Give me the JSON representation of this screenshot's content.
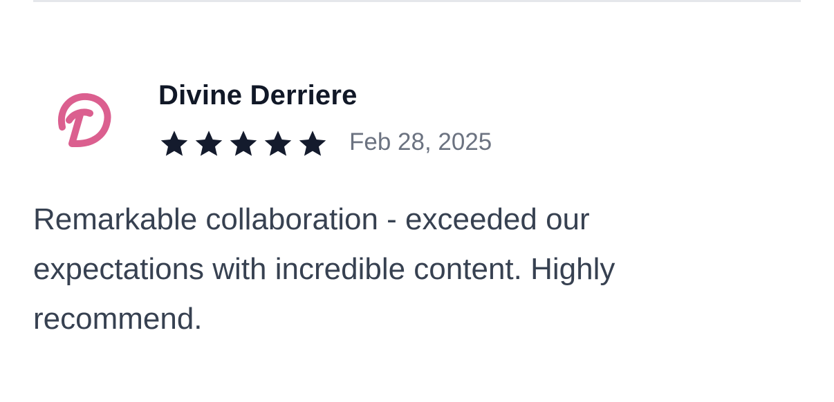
{
  "review": {
    "author": "Divine Derriere",
    "avatar_icon": "divine-derriere-d-logo",
    "avatar_color": "#db5f8f",
    "rating": 5,
    "rating_max": 5,
    "star_color": "#141b2d",
    "date": "Feb 28, 2025",
    "body": "Remarkable collaboration - exceeded our expectations with incredible content. Highly recommend."
  }
}
